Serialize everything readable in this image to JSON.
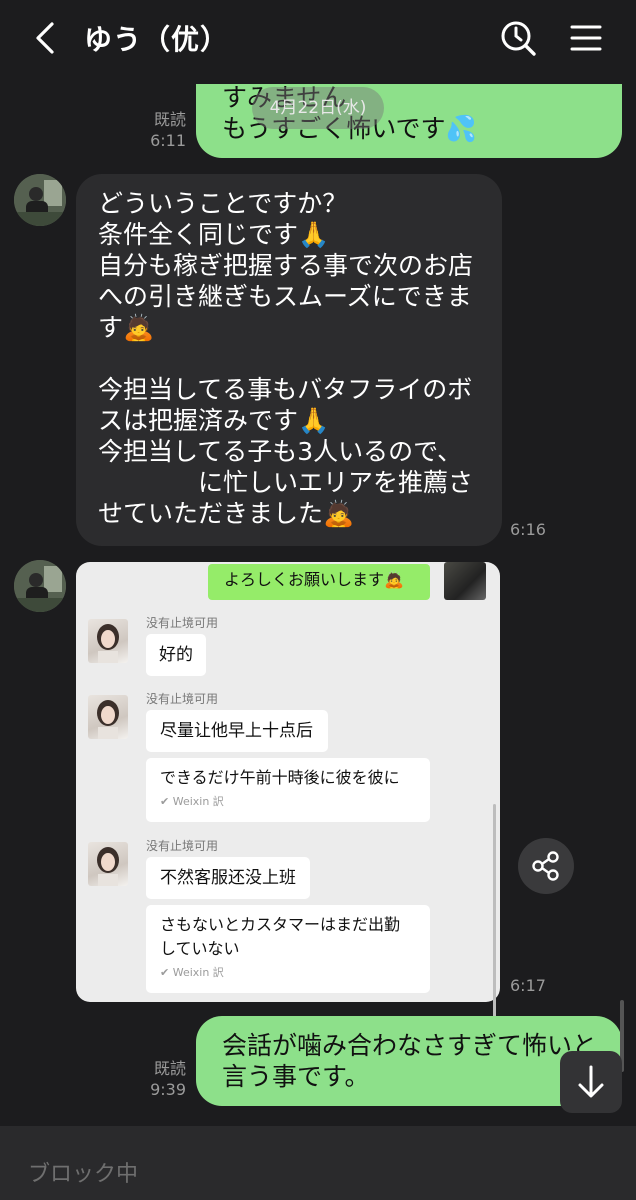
{
  "header": {
    "title": "ゆう（优）",
    "icons": [
      "back-chevron-icon",
      "search-icon",
      "menu-icon"
    ]
  },
  "date_pill": "4月22日(水)",
  "messages": {
    "out1": {
      "read": "既読",
      "time": "6:11",
      "text": "すみません\nもうすごく怖いです💦"
    },
    "in1": {
      "time": "6:16",
      "text": "どういうことですか？\n条件全く同じです🙏\n自分も稼ぎ把握する事で次のお店への引き継ぎもスムーズにできます🙇\n\n今担当してる事もバタフライのボスは把握済みです🙏\n今担当してる子も3人いるので、\n　　　　に忙しいエリアを推薦させていただきました🙇"
    },
    "in2": {
      "time": "6:17",
      "screenshot": {
        "top_message": "よろしくお願いします🙇",
        "groups": [
          {
            "nick": "没有止境可用",
            "bubbles": [
              "好的"
            ]
          },
          {
            "nick": "没有止境可用",
            "bubbles": [
              "尽量让他早上十点后"
            ],
            "translation": "できるだけ午前十時後に彼を彼に",
            "translation_source": "Weixin 訳"
          },
          {
            "nick": "没有止境可用",
            "bubbles": [
              "不然客服还没上班"
            ],
            "translation": "さもないとカスタマーはまだ出勤していない",
            "translation_source": "Weixin 訳"
          }
        ]
      }
    },
    "out2": {
      "read": "既読",
      "time": "9:39",
      "text": "会話が噛み合わなさすぎて怖いと言う事です。"
    }
  },
  "footer": {
    "status": "ブロック中"
  },
  "colors": {
    "background": "#1c1c1e",
    "outgoing_bubble": "#8de08a",
    "incoming_bubble": "#2c2c2e",
    "meta_text": "#9a9a9a"
  }
}
